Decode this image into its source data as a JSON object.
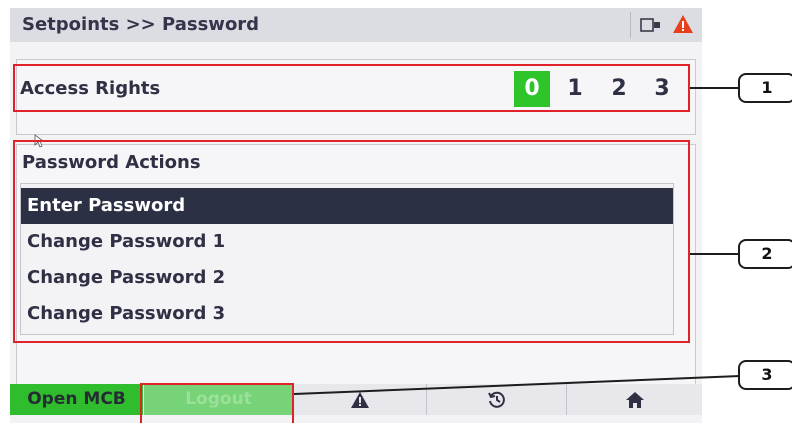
{
  "header": {
    "title": "Setpoints >> Password",
    "icons": [
      "camera-icon",
      "warning-icon"
    ],
    "warning_color": "#e8401c"
  },
  "access_rights": {
    "label": "Access Rights",
    "levels": [
      "0",
      "1",
      "2",
      "3"
    ],
    "active_level": "0",
    "active_color": "#2ec52b"
  },
  "password_actions": {
    "label": "Password Actions",
    "items": [
      "Enter Password",
      "Change Password 1",
      "Change Password 2",
      "Change Password 3"
    ],
    "selected": "Enter Password"
  },
  "bottom_bar": {
    "open_mcb_label": "Open MCB",
    "logout_label": "Logout",
    "tabs": [
      "alarm-icon",
      "history-icon",
      "home-icon"
    ]
  },
  "callouts": [
    "1",
    "2",
    "3"
  ]
}
